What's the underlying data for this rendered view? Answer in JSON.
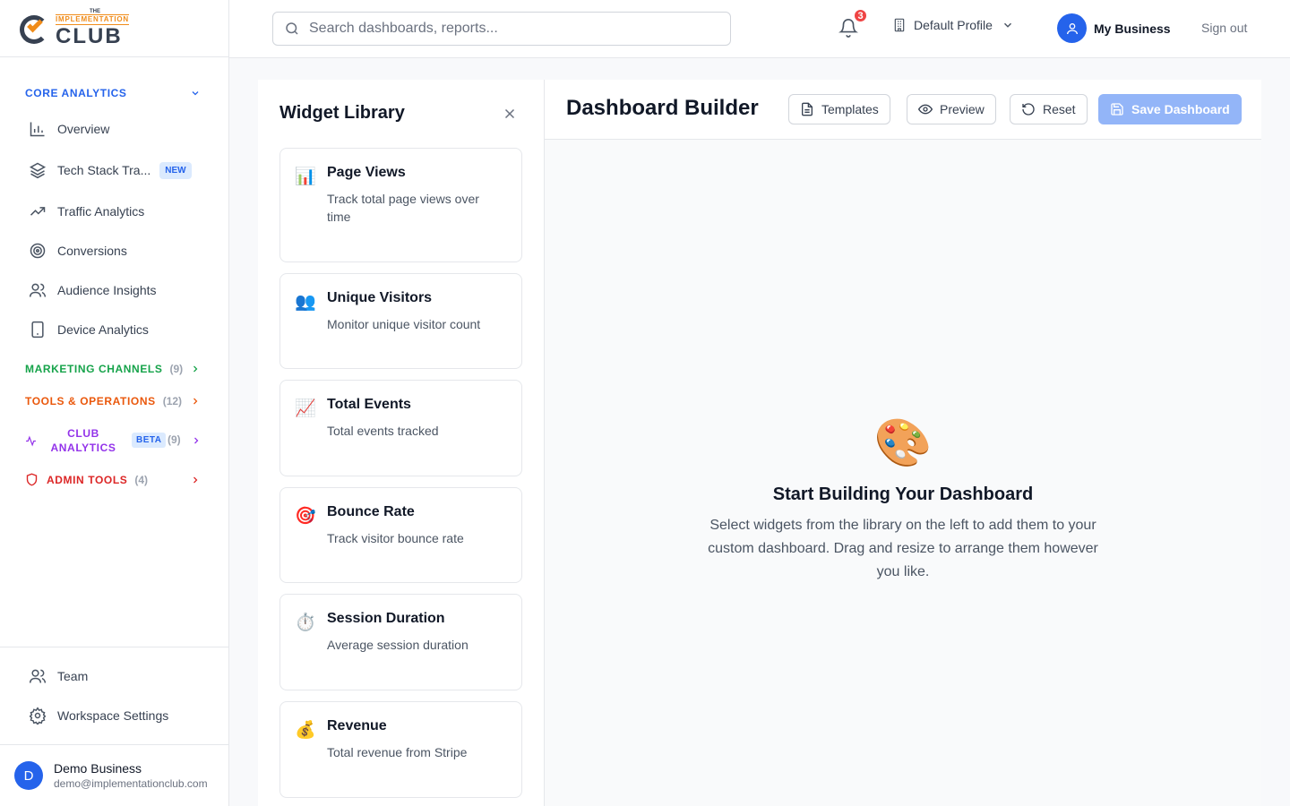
{
  "brand": {
    "the": "THE",
    "implementation": "IMPLEMENTATION",
    "club": "CLUB"
  },
  "sidebar": {
    "core": {
      "label": "CORE ANALYTICS",
      "color": "#2563eb"
    },
    "items": [
      {
        "label": "Overview",
        "icon": "bar-chart-icon"
      },
      {
        "label": "Tech Stack Tra...",
        "icon": "layers-icon",
        "badge": "NEW"
      },
      {
        "label": "Traffic Analytics",
        "icon": "trending-up-icon"
      },
      {
        "label": "Conversions",
        "icon": "target-icon"
      },
      {
        "label": "Audience Insights",
        "icon": "users-icon"
      },
      {
        "label": "Device Analytics",
        "icon": "tablet-icon"
      }
    ],
    "marketing": {
      "label": "MARKETING CHANNELS",
      "count": "(9)",
      "color": "#16a34a"
    },
    "tools": {
      "label": "TOOLS & OPERATIONS",
      "count": "(12)",
      "color": "#ea580c"
    },
    "club": {
      "label_line1": "CLUB",
      "label_line2": "ANALYTICS",
      "badge": "BETA",
      "count": "(9)",
      "color": "#9333ea"
    },
    "admin": {
      "label": "ADMIN TOOLS",
      "count": "(4)",
      "color": "#dc2626"
    },
    "bottom": [
      {
        "label": "Team",
        "icon": "users-icon"
      },
      {
        "label": "Workspace Settings",
        "icon": "gear-icon"
      }
    ],
    "user": {
      "initial": "D",
      "name": "Demo Business",
      "email": "demo@implementationclub.com"
    }
  },
  "header": {
    "search_placeholder": "Search dashboards, reports...",
    "notifications": "3",
    "profile": "Default Profile",
    "business": "My Business",
    "signout": "Sign out"
  },
  "library": {
    "title": "Widget Library",
    "widgets": [
      {
        "icon": "📊",
        "title": "Page Views",
        "desc": "Track total page views over time"
      },
      {
        "icon": "👥",
        "title": "Unique Visitors",
        "desc": "Monitor unique visitor count"
      },
      {
        "icon": "📈",
        "title": "Total Events",
        "desc": "Total events tracked"
      },
      {
        "icon": "🎯",
        "title": "Bounce Rate",
        "desc": "Track visitor bounce rate"
      },
      {
        "icon": "⏱️",
        "title": "Session Duration",
        "desc": "Average session duration"
      },
      {
        "icon": "💰",
        "title": "Revenue",
        "desc": "Total revenue from Stripe"
      }
    ]
  },
  "builder": {
    "title": "Dashboard Builder",
    "templates": "Templates",
    "preview": "Preview",
    "reset": "Reset",
    "save": "Save Dashboard",
    "empty_icon": "🎨",
    "empty_title": "Start Building Your Dashboard",
    "empty_desc": "Select widgets from the library on the left to add them to your custom dashboard. Drag and resize to arrange them however you like."
  }
}
